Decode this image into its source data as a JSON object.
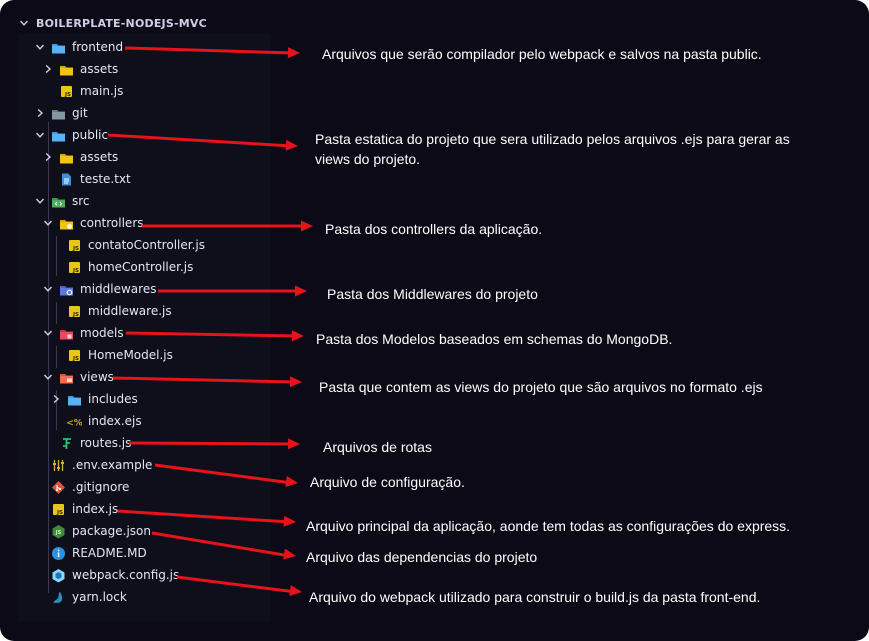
{
  "explorer": {
    "root_label": "BOILERPLATE-NODEJS-MVC",
    "rows": [
      {
        "label": "frontend",
        "depth": 0,
        "chevron": "down",
        "icon": "folder-blue-icon"
      },
      {
        "label": "assets",
        "depth": 1,
        "chevron": "right",
        "icon": "folder-yellow-icon"
      },
      {
        "label": "main.js",
        "depth": 1,
        "chevron": "",
        "icon": "js-file-icon"
      },
      {
        "label": "git",
        "depth": 0,
        "chevron": "right",
        "icon": "folder-gray-icon"
      },
      {
        "label": "public",
        "depth": 0,
        "chevron": "down",
        "icon": "folder-blue-icon"
      },
      {
        "label": "assets",
        "depth": 1,
        "chevron": "right",
        "icon": "folder-yellow-icon"
      },
      {
        "label": "teste.txt",
        "depth": 1,
        "chevron": "",
        "icon": "text-file-icon"
      },
      {
        "label": "src",
        "depth": 0,
        "chevron": "down",
        "icon": "folder-src-icon"
      },
      {
        "label": "controllers",
        "depth": 1,
        "chevron": "down",
        "icon": "folder-controllers-icon"
      },
      {
        "label": "contatoController.js",
        "depth": 2,
        "chevron": "",
        "icon": "js-file-icon"
      },
      {
        "label": "homeController.js",
        "depth": 2,
        "chevron": "",
        "icon": "js-file-icon"
      },
      {
        "label": "middlewares",
        "depth": 1,
        "chevron": "down",
        "icon": "folder-middleware-icon"
      },
      {
        "label": "middleware.js",
        "depth": 2,
        "chevron": "",
        "icon": "js-file-icon"
      },
      {
        "label": "models",
        "depth": 1,
        "chevron": "down",
        "icon": "folder-models-icon"
      },
      {
        "label": "HomeModel.js",
        "depth": 2,
        "chevron": "",
        "icon": "js-file-icon"
      },
      {
        "label": "views",
        "depth": 1,
        "chevron": "down",
        "icon": "folder-views-icon"
      },
      {
        "label": "includes",
        "depth": 2,
        "chevron": "right",
        "icon": "folder-blue-icon"
      },
      {
        "label": "index.ejs",
        "depth": 2,
        "chevron": "",
        "icon": "ejs-file-icon"
      },
      {
        "label": "routes.js",
        "depth": 1,
        "chevron": "",
        "icon": "routes-file-icon"
      },
      {
        "label": ".env.example",
        "depth": 0,
        "chevron": "",
        "icon": "env-file-icon"
      },
      {
        "label": ".gitignore",
        "depth": 0,
        "chevron": "",
        "icon": "git-file-icon"
      },
      {
        "label": "index.js",
        "depth": 0,
        "chevron": "",
        "icon": "js-file-icon"
      },
      {
        "label": "package.json",
        "depth": 0,
        "chevron": "",
        "icon": "nodejs-file-icon"
      },
      {
        "label": "README.MD",
        "depth": 0,
        "chevron": "",
        "icon": "info-file-icon"
      },
      {
        "label": "webpack.config.js",
        "depth": 0,
        "chevron": "",
        "icon": "webpack-file-icon"
      },
      {
        "label": "yarn.lock",
        "depth": 0,
        "chevron": "",
        "icon": "yarn-file-icon"
      }
    ]
  },
  "annotations": [
    {
      "name": "note-frontend",
      "text": "Arquivos que serão compilador pelo webpack e salvos na pasta public."
    },
    {
      "name": "note-public",
      "text": "Pasta estatica do projeto que sera utilizado pelos arquivos .ejs para gerar as views do projeto."
    },
    {
      "name": "note-controllers",
      "text": "Pasta dos controllers da aplicação."
    },
    {
      "name": "note-middlewares",
      "text": "Pasta dos Middlewares do projeto"
    },
    {
      "name": "note-models",
      "text": "Pasta dos Modelos baseados em schemas do MongoDB."
    },
    {
      "name": "note-views",
      "text": "Pasta que contem as views do projeto que são arquivos no formato .ejs"
    },
    {
      "name": "note-routes",
      "text": "Arquivos de rotas"
    },
    {
      "name": "note-env",
      "text": "Arquivo de configuração."
    },
    {
      "name": "note-index",
      "text": "Arquivo principal da aplicação, aonde tem todas as configurações do express."
    },
    {
      "name": "note-package",
      "text": "Arquivo das dependencias do projeto"
    },
    {
      "name": "note-webpack",
      "text": "Arquivo do webpack utilizado para construir o build.js da pasta front-end."
    }
  ],
  "colors": {
    "arrow": "#e8121a",
    "background": "#0c0a16",
    "sidebar": "#0f0e1b"
  }
}
